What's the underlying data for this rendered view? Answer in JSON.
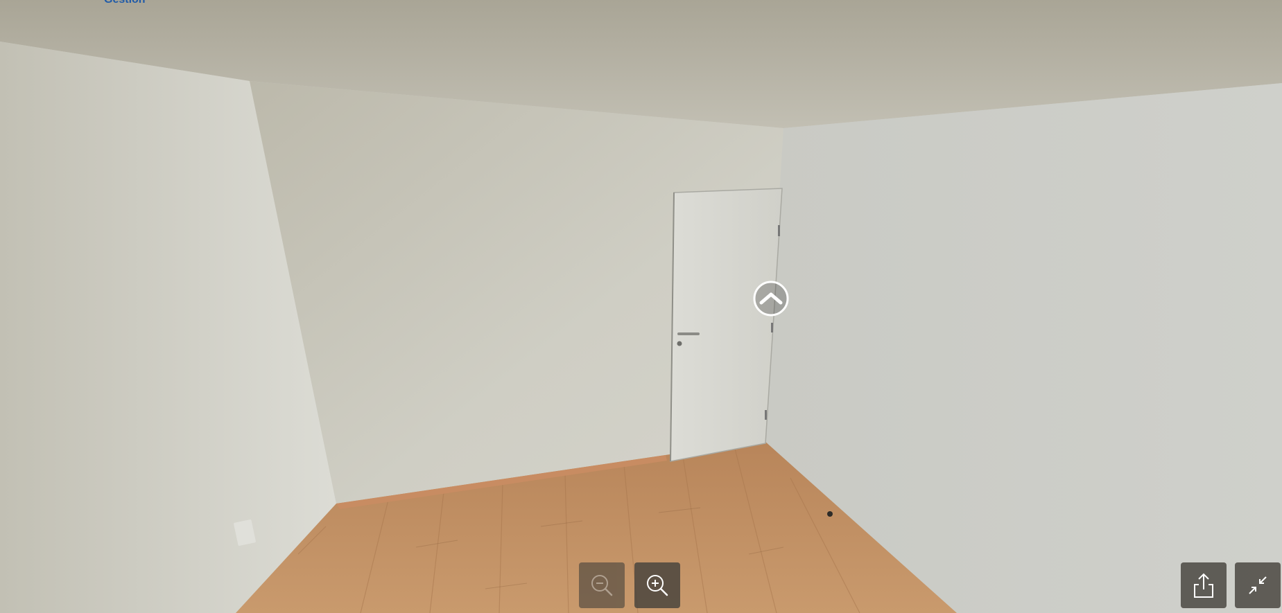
{
  "brand": {
    "text": "Gestion"
  },
  "viewer": {
    "mode": "360-panorama"
  },
  "controls": {
    "zoom_out": {
      "icon": "zoom-out-icon",
      "state": "disabled"
    },
    "zoom_in": {
      "icon": "zoom-in-icon",
      "state": "enabled"
    },
    "share": {
      "icon": "share-icon"
    },
    "exit_fullscreen": {
      "icon": "collapse-icon"
    }
  },
  "hotspot": {
    "icon": "chevron-up-icon"
  },
  "colors": {
    "brand": "#1f5aa8",
    "control_bg": "#46423c",
    "icon": "#ffffff"
  }
}
